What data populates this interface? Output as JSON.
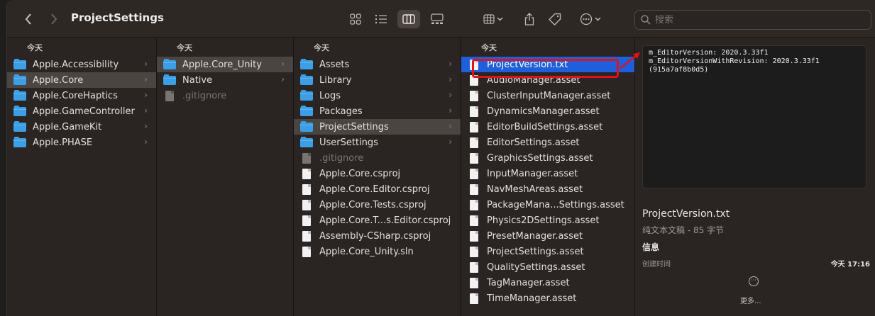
{
  "toolbar": {
    "title": "ProjectSettings",
    "search_placeholder": "搜索",
    "back_icon": "chevron-left-icon",
    "forward_icon": "chevron-right-icon"
  },
  "columns": [
    {
      "header": "今天",
      "items": [
        {
          "label": "Apple.Accessibility",
          "type": "folder",
          "chevron": "›"
        },
        {
          "label": "Apple.Core",
          "type": "folder",
          "chevron": "›",
          "state": "selected"
        },
        {
          "label": "Apple.CoreHaptics",
          "type": "folder",
          "chevron": "›"
        },
        {
          "label": "Apple.GameController",
          "type": "folder",
          "chevron": "›"
        },
        {
          "label": "Apple.GameKit",
          "type": "folder",
          "chevron": "›"
        },
        {
          "label": "Apple.PHASE",
          "type": "folder",
          "chevron": "›"
        }
      ]
    },
    {
      "header": "今天",
      "items": [
        {
          "label": "Apple.Core_Unity",
          "type": "folder",
          "chevron": "›",
          "state": "selected"
        },
        {
          "label": "Native",
          "type": "folder",
          "chevron": "›"
        },
        {
          "label": ".gitignore",
          "type": "doc-dim"
        }
      ]
    },
    {
      "header": "今天",
      "items": [
        {
          "label": "Assets",
          "type": "folder",
          "chevron": "›"
        },
        {
          "label": "Library",
          "type": "folder",
          "chevron": "›"
        },
        {
          "label": "Logs",
          "type": "folder",
          "chevron": "›"
        },
        {
          "label": "Packages",
          "type": "folder",
          "chevron": "›"
        },
        {
          "label": "ProjectSettings",
          "type": "folder",
          "chevron": "›",
          "state": "selected"
        },
        {
          "label": "UserSettings",
          "type": "folder",
          "chevron": "›"
        },
        {
          "label": ".gitignore",
          "type": "doc-dim"
        },
        {
          "label": "Apple.Core.csproj",
          "type": "doc"
        },
        {
          "label": "Apple.Core.Editor.csproj",
          "type": "doc"
        },
        {
          "label": "Apple.Core.Tests.csproj",
          "type": "doc"
        },
        {
          "label": "Apple.Core.T...s.Editor.csproj",
          "type": "doc"
        },
        {
          "label": "Assembly-CSharp.csproj",
          "type": "doc"
        },
        {
          "label": "Apple.Core_Unity.sln",
          "type": "doc"
        }
      ]
    },
    {
      "header": "今天",
      "items": [
        {
          "label": "ProjectVersion.txt",
          "type": "doc",
          "state": "active"
        },
        {
          "label": "AudioManager.asset",
          "type": "doc"
        },
        {
          "label": "ClusterInputManager.asset",
          "type": "doc"
        },
        {
          "label": "DynamicsManager.asset",
          "type": "doc"
        },
        {
          "label": "EditorBuildSettings.asset",
          "type": "doc"
        },
        {
          "label": "EditorSettings.asset",
          "type": "doc"
        },
        {
          "label": "GraphicsSettings.asset",
          "type": "doc"
        },
        {
          "label": "InputManager.asset",
          "type": "doc"
        },
        {
          "label": "NavMeshAreas.asset",
          "type": "doc"
        },
        {
          "label": "PackageMana...Settings.asset",
          "type": "doc"
        },
        {
          "label": "Physics2DSettings.asset",
          "type": "doc"
        },
        {
          "label": "PresetManager.asset",
          "type": "doc"
        },
        {
          "label": "ProjectSettings.asset",
          "type": "doc"
        },
        {
          "label": "QualitySettings.asset",
          "type": "doc"
        },
        {
          "label": "TagManager.asset",
          "type": "doc"
        },
        {
          "label": "TimeManager.asset",
          "type": "doc"
        }
      ]
    }
  ],
  "preview": {
    "content": "m_EditorVersion: 2020.3.33f1\nm_EditorVersionWithRevision: 2020.3.33f1\n(915a7af8b0d5)",
    "filename": "ProjectVersion.txt",
    "kind": "纯文本文稿 - 85 字节",
    "info_heading": "信息",
    "created_label": "创建时间",
    "created_value": "今天 17:16",
    "more_label": "更多..."
  },
  "colors": {
    "selection_blue": "#1f5fdc",
    "folder_blue": "#3c9fe6",
    "highlight_red": "#e0121b"
  }
}
